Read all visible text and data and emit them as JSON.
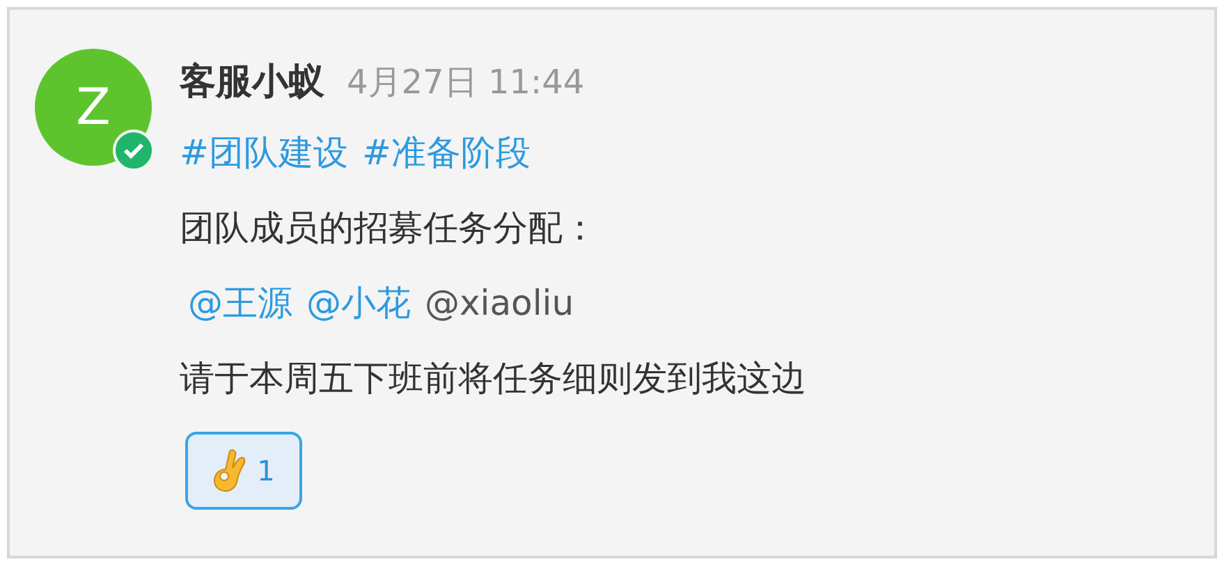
{
  "message": {
    "avatar": {
      "initial": "Z",
      "verified": true
    },
    "author": "客服小蚁",
    "time": "4月27日 11:44",
    "tags": [
      "#团队建设",
      "#准备阶段"
    ],
    "body": "团队成员的招募任务分配：",
    "mentions": [
      {
        "text": "@王源",
        "highlighted": true
      },
      {
        "text": "@小花",
        "highlighted": true
      },
      {
        "text": "@xiaoliu",
        "highlighted": false
      }
    ],
    "request": "请于本周五下班前将任务细则发到我这边",
    "reactions": [
      {
        "count": "1",
        "selected": true
      }
    ]
  }
}
